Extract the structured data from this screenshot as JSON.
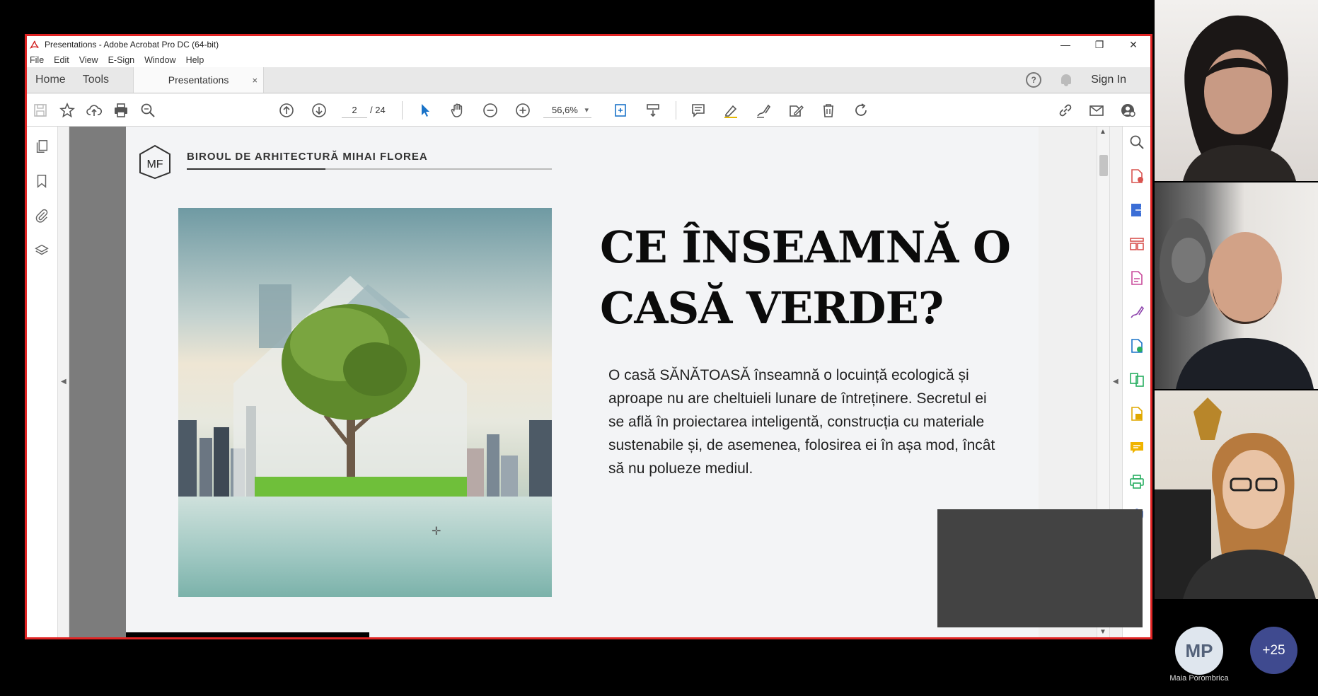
{
  "window": {
    "title": "Presentations - Adobe Acrobat Pro DC (64-bit)",
    "controls": {
      "minimize": "—",
      "restore": "❐",
      "close": "✕"
    }
  },
  "menu": [
    "File",
    "Edit",
    "View",
    "E-Sign",
    "Window",
    "Help"
  ],
  "tabs": {
    "home": "Home",
    "tools": "Tools",
    "document": "Presentations",
    "close": "×",
    "help": "?",
    "sign_in": "Sign In"
  },
  "toolbar": {
    "current_page": "2",
    "total_pages": "/  24",
    "zoom": "56,6%"
  },
  "slide": {
    "logo_initials": "MF",
    "brand": "BIROUL DE ARHITECTURĂ MIHAI FLOREA",
    "headline_line1": "CE ÎNSEAMNĂ O",
    "headline_line2": "CASĂ VERDE?",
    "body": "O casă SĂNĂTOASĂ înseamnă o locuință ecologică și aproape nu are cheltuieli lunare de întreținere. Secretul ei se află în proiectarea inteligentă, construcția cu materiale sustenabile și, de asemenea, folosirea ei în așa mod, încât să nu polueze mediul."
  },
  "participants": {
    "avatar_initials": "MP",
    "avatar_name": "Maia Porombrica",
    "more_count": "+25"
  },
  "colors": {
    "window_border": "#e02424",
    "accent_blue": "#1a73c8",
    "more_badge": "#3f4a8f"
  }
}
